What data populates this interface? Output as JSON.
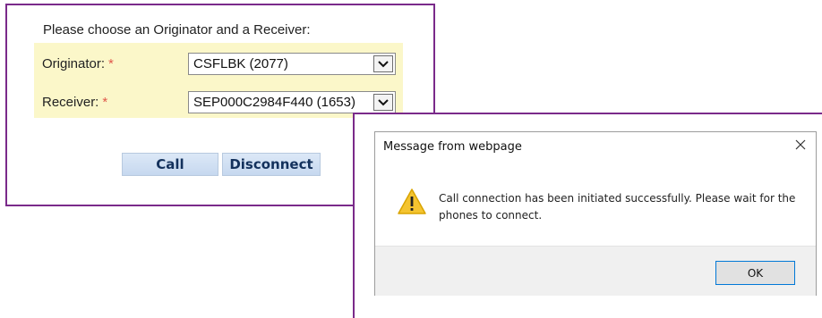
{
  "form": {
    "heading": "Please choose an Originator and a Receiver:",
    "required_marker": "*",
    "originator": {
      "label": "Originator:",
      "value": "CSFLBK (2077)"
    },
    "receiver": {
      "label": "Receiver:",
      "value": "SEP000C2984F440 (1653)"
    },
    "call_label": "Call",
    "disconnect_label": "Disconnect"
  },
  "dialog": {
    "title": "Message from webpage",
    "message": "Call connection has been initiated successfully. Please wait for the phones to connect.",
    "ok_label": "OK",
    "icon": "warning-icon"
  },
  "colors": {
    "frame_border": "#7a2a8a",
    "form_row_bg": "#fbf7c9",
    "required": "#e0584b",
    "button_text": "#13315c",
    "warning": "#f4c430",
    "ok_border": "#0078d7"
  }
}
